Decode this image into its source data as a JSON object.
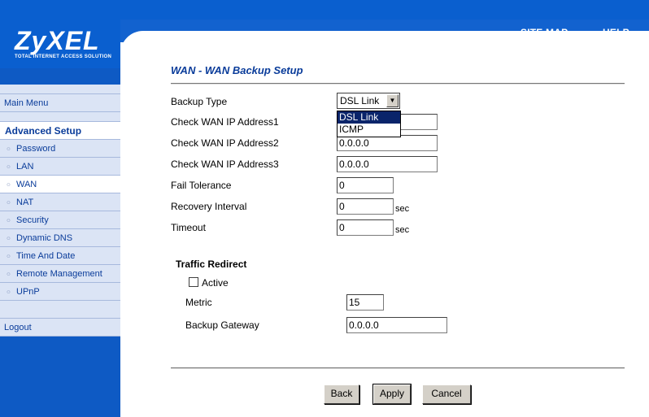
{
  "brand": {
    "logo": "ZyXEL",
    "tagline": "TOTAL INTERNET ACCESS SOLUTION"
  },
  "header": {
    "site_map": "SITE MAP",
    "help": "HELP"
  },
  "sidebar": {
    "main_menu": "Main Menu",
    "section": "Advanced Setup",
    "items": [
      {
        "label": "Password"
      },
      {
        "label": "LAN"
      },
      {
        "label": "WAN"
      },
      {
        "label": "NAT"
      },
      {
        "label": "Security"
      },
      {
        "label": "Dynamic DNS"
      },
      {
        "label": "Time And Date"
      },
      {
        "label": "Remote Management"
      },
      {
        "label": "UPnP"
      }
    ],
    "logout": "Logout"
  },
  "page": {
    "title": "WAN - WAN Backup Setup"
  },
  "form": {
    "backup_type": {
      "label": "Backup Type",
      "value": "DSL Link",
      "options": [
        "DSL Link",
        "ICMP"
      ]
    },
    "check_wan_ip_1": {
      "label": "Check WAN IP Address1",
      "value": ""
    },
    "check_wan_ip_2": {
      "label": "Check WAN IP Address2",
      "value": "0.0.0.0"
    },
    "check_wan_ip_3": {
      "label": "Check WAN IP Address3",
      "value": "0.0.0.0"
    },
    "fail_tolerance": {
      "label": "Fail Tolerance",
      "value": "0"
    },
    "recovery_interval": {
      "label": "Recovery Interval",
      "value": "0",
      "unit": "sec"
    },
    "timeout": {
      "label": "Timeout",
      "value": "0",
      "unit": "sec"
    }
  },
  "traffic_redirect": {
    "heading": "Traffic Redirect",
    "active_label": "Active",
    "active_checked": false,
    "metric": {
      "label": "Metric",
      "value": "15"
    },
    "backup_gateway": {
      "label": "Backup Gateway",
      "value": "0.0.0.0"
    }
  },
  "buttons": {
    "back": "Back",
    "apply": "Apply",
    "cancel": "Cancel"
  },
  "colors": {
    "brand_blue": "#0a5fcf",
    "sidebar_blue": "#0e5ac4",
    "title_blue": "#0a3c9a",
    "menu_bg": "#dbe4f5"
  }
}
